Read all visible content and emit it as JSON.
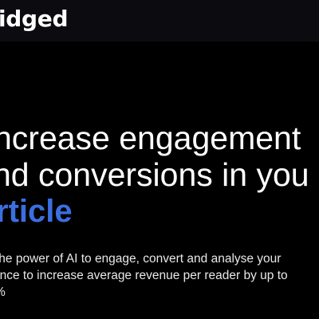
{
  "navbar": {
    "logo_text": "idged"
  },
  "hero": {
    "headline_line1": "ncrease engagement",
    "headline_line2": "nd conversions in you",
    "headline_highlight": "rticle",
    "subtext_line1": "the power of AI to engage, convert and analyse your",
    "subtext_line2": "ence to increase average revenue per reader by up to",
    "subtext_line3": "%"
  },
  "colors": {
    "background": "#000000",
    "navbar": "#0b0b10",
    "accent": "#3b6fe0",
    "text": "#ffffff"
  }
}
